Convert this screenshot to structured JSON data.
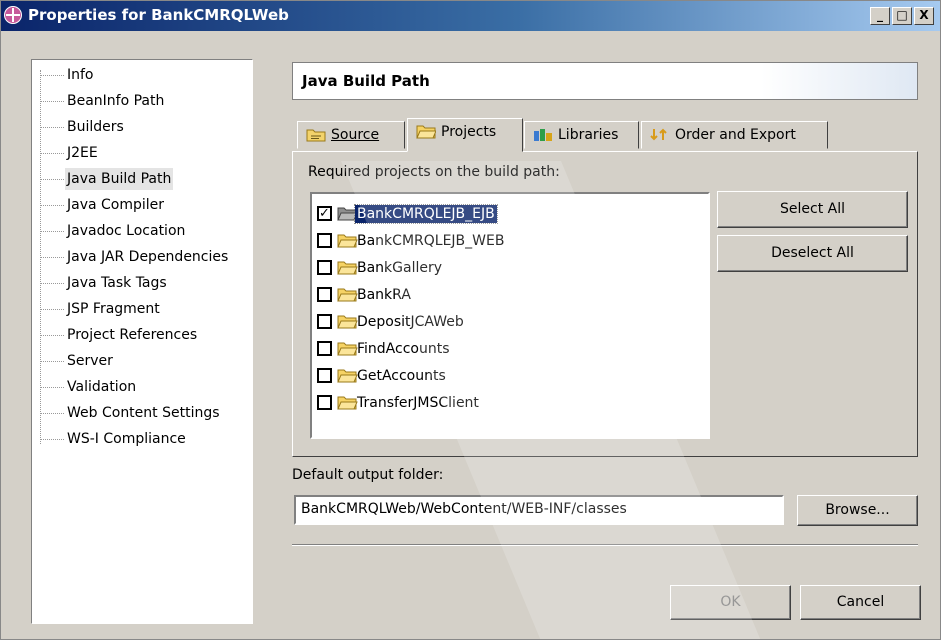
{
  "window": {
    "title": "Properties for BankCMRQLWeb",
    "controls": [
      "_",
      "□",
      "X"
    ]
  },
  "sidebar": {
    "items": [
      {
        "label": "Info"
      },
      {
        "label": "BeanInfo Path"
      },
      {
        "label": "Builders"
      },
      {
        "label": "J2EE"
      },
      {
        "label": "Java Build Path",
        "selected": true
      },
      {
        "label": "Java Compiler"
      },
      {
        "label": "Javadoc Location"
      },
      {
        "label": "Java JAR Dependencies"
      },
      {
        "label": "Java Task Tags"
      },
      {
        "label": "JSP Fragment"
      },
      {
        "label": "Project References"
      },
      {
        "label": "Server"
      },
      {
        "label": "Validation"
      },
      {
        "label": "Web Content Settings"
      },
      {
        "label": "WS-I Compliance"
      }
    ]
  },
  "page": {
    "title": "Java Build Path"
  },
  "tabs": [
    {
      "label": "Source",
      "icon": "source-folder-icon"
    },
    {
      "label": "Projects",
      "icon": "project-folder-icon",
      "active": true
    },
    {
      "label": "Libraries",
      "icon": "libraries-icon"
    },
    {
      "label": "Order and Export",
      "icon": "order-icon"
    }
  ],
  "projects": {
    "label": "Required projects on the build path:",
    "items": [
      {
        "name": "BankCMRQLEJB_EJB",
        "checked": true,
        "selected": true
      },
      {
        "name": "BankCMRQLEJB_WEB",
        "checked": false
      },
      {
        "name": "BankGallery",
        "checked": false
      },
      {
        "name": "BankRA",
        "checked": false
      },
      {
        "name": "DepositJCAWeb",
        "checked": false
      },
      {
        "name": "FindAccounts",
        "checked": false
      },
      {
        "name": "GetAccounts",
        "checked": false
      },
      {
        "name": "TransferJMSClient",
        "checked": false
      }
    ],
    "select_all": "Select All",
    "deselect_all": "Deselect All"
  },
  "output": {
    "label": "Default output folder:",
    "value": "BankCMRQLWeb/WebContent/WEB-INF/classes",
    "browse": "Browse..."
  },
  "footer": {
    "ok": "OK",
    "cancel": "Cancel"
  },
  "colors": {
    "selection": "#0a246a",
    "face": "#d4d0c8",
    "titlebar": "#0a246a"
  }
}
